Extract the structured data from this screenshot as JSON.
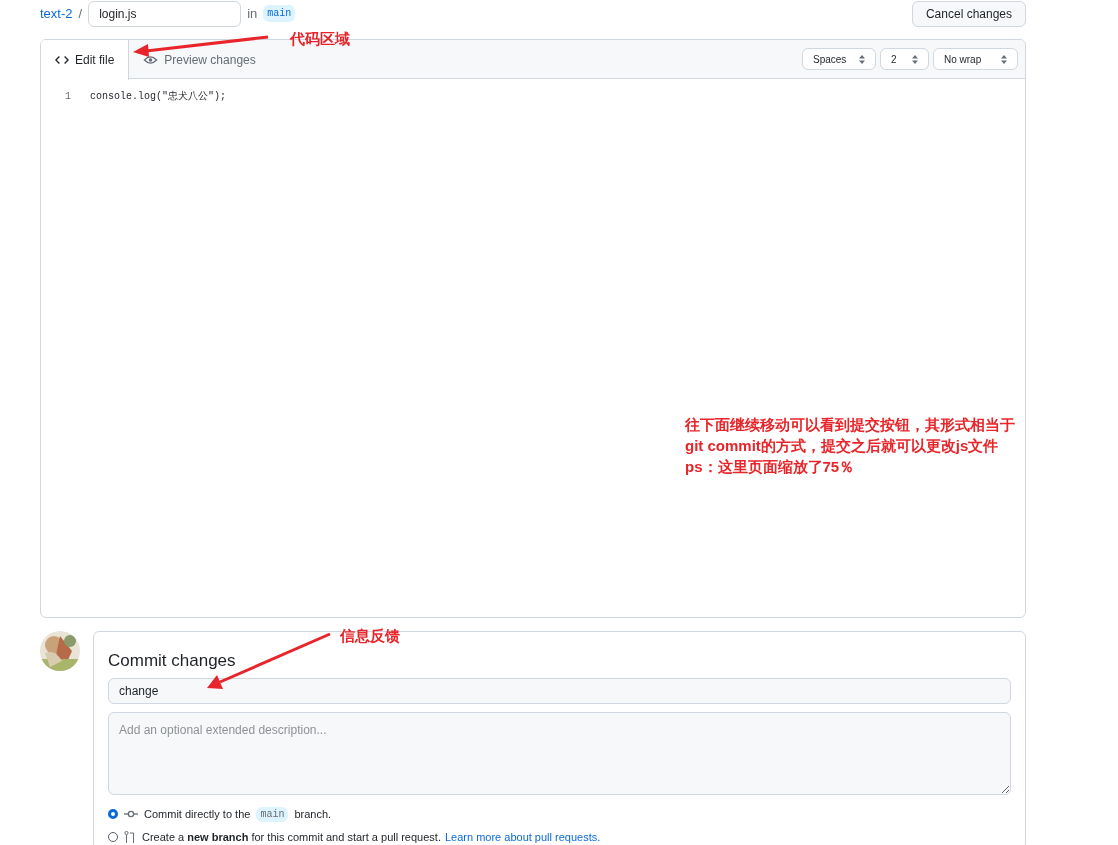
{
  "breadcrumb": {
    "repo": "text-2",
    "separator": "/",
    "filename": "login.js",
    "in_label": "in",
    "branch": "main"
  },
  "cancel_button": "Cancel changes",
  "editor": {
    "tabs": [
      {
        "label": "Edit file",
        "selected": true
      },
      {
        "label": "Preview changes",
        "selected": false
      }
    ],
    "selects": [
      "Spaces",
      "2",
      "No wrap"
    ],
    "lines": [
      {
        "number": "1",
        "code": "console.log(\"忠犬八公\");"
      }
    ]
  },
  "commit": {
    "title": "Commit changes",
    "summary": "change",
    "description_placeholder": "Add an optional extended description...",
    "options": [
      {
        "label": "Commit directly to the",
        "branch": "main",
        "suffix": "branch.",
        "selected": true
      },
      {
        "label": "Create a **new branch** for this commit and start a pull request.",
        "link": "Learn more about pull requests.",
        "selected": false
      }
    ]
  },
  "annotations": {
    "code_area": "代码区域",
    "feedback": "信息反馈",
    "note": [
      "往下面继续移动可以看到提交按钮，其形式相当于",
      "git commit的方式，提交之后就可以更改js文件",
      "ps：这里页面缩放了75％"
    ]
  }
}
